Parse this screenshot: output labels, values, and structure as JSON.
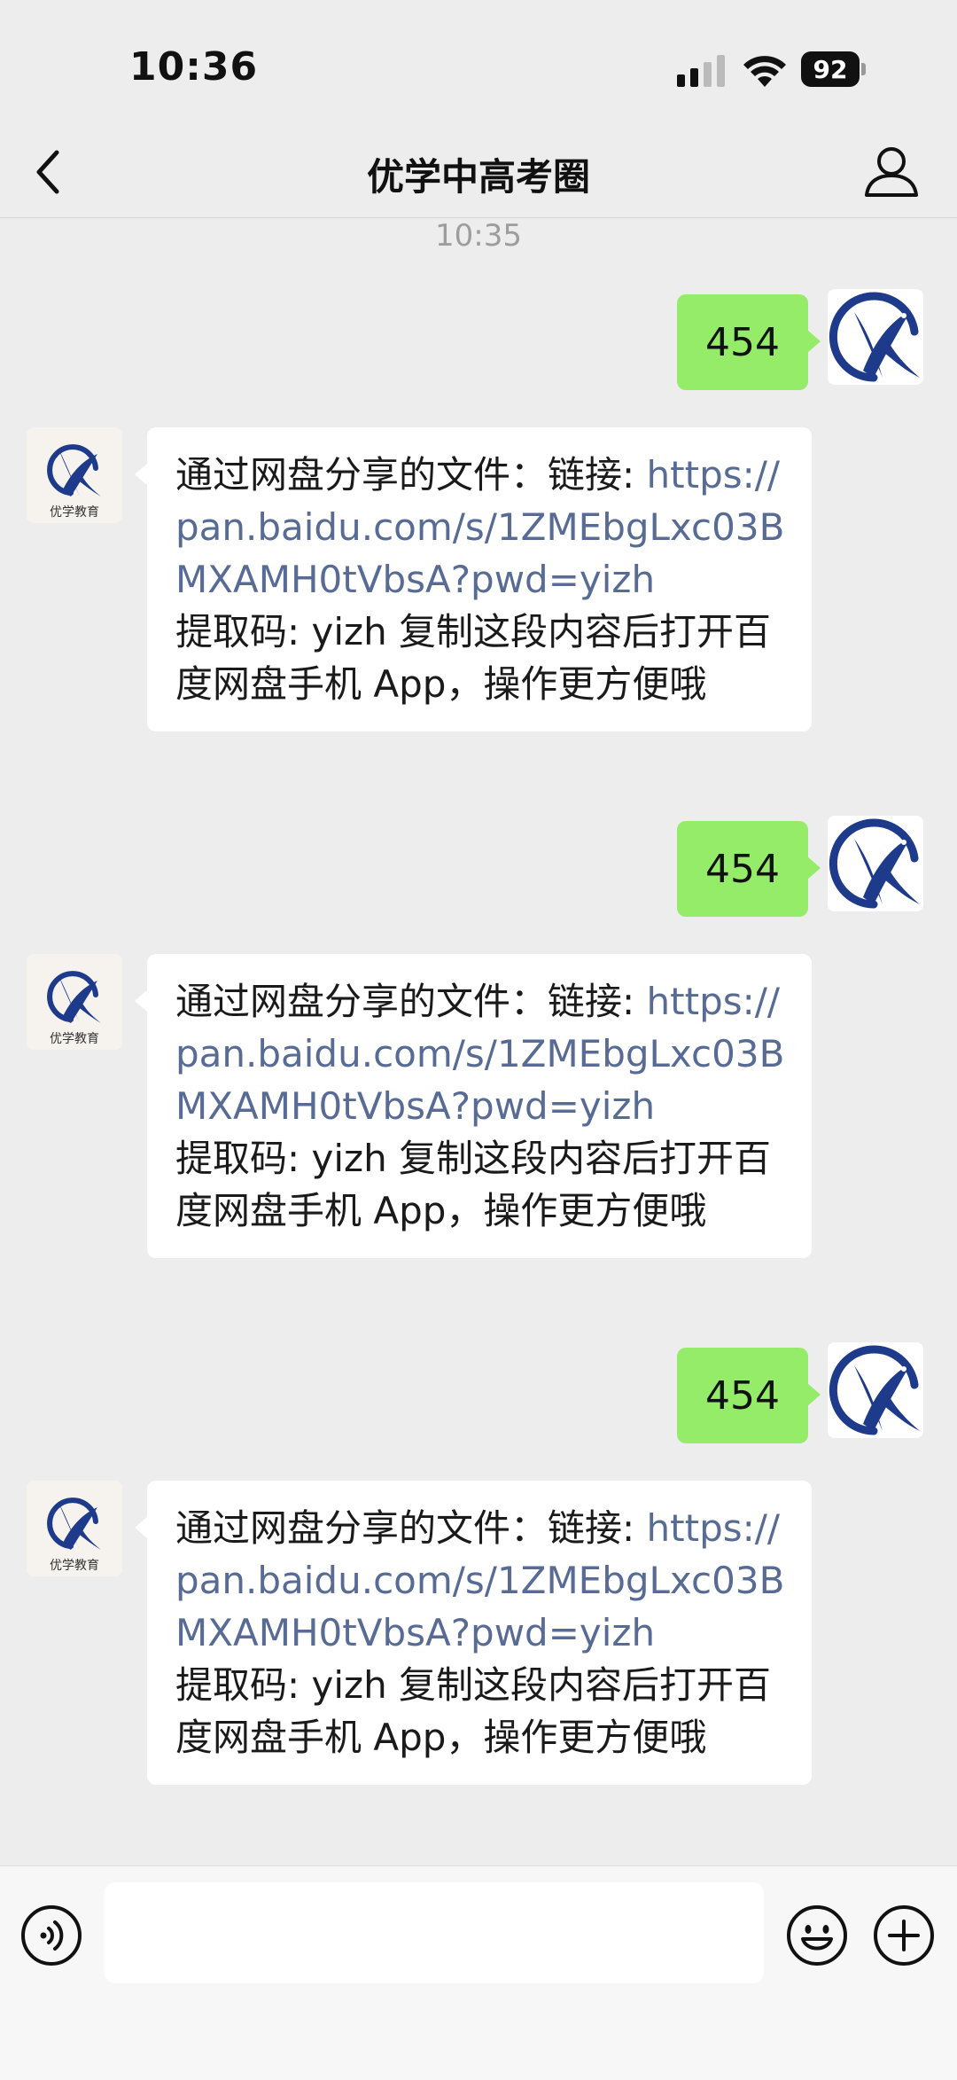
{
  "status_bar": {
    "time": "10:36",
    "battery": "92"
  },
  "header": {
    "title": "优学中高考圈"
  },
  "avatars": {
    "incoming_logo_text": "优学教育"
  },
  "messages": {
    "timestamp": "10:35",
    "items": [
      {
        "direction": "out",
        "text": "454"
      },
      {
        "direction": "in",
        "prefix": "通过网盘分享的文件：链接: ",
        "link": "https://pan.baidu.com/s/1ZMEbgLxc03BMXAMH0tVbsA?pwd=yizh",
        "suffix": "提取码: yizh 复制这段内容后打开百度网盘手机 App，操作更方便哦"
      },
      {
        "direction": "out",
        "text": "454"
      },
      {
        "direction": "in",
        "prefix": "通过网盘分享的文件：链接: ",
        "link": "https://pan.baidu.com/s/1ZMEbgLxc03BMXAMH0tVbsA?pwd=yizh",
        "suffix": "提取码: yizh 复制这段内容后打开百度网盘手机 App，操作更方便哦"
      },
      {
        "direction": "out",
        "text": "454"
      },
      {
        "direction": "in",
        "prefix": "通过网盘分享的文件：链接: ",
        "link": "https://pan.baidu.com/s/1ZMEbgLxc03BMXAMH0tVbsA?pwd=yizh",
        "suffix": "提取码: yizh 复制这段内容后打开百度网盘手机 App，操作更方便哦"
      }
    ]
  },
  "input_bar": {
    "placeholder": ""
  },
  "colors": {
    "bubble_out": "#95ec69",
    "bubble_in": "#ffffff",
    "link": "#576b95",
    "logo_blue": "#1e3a8a"
  }
}
